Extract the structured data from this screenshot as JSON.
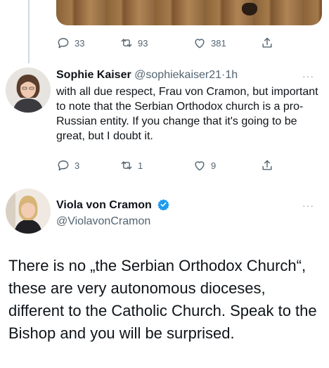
{
  "top_tweet": {
    "actions": {
      "replies": "33",
      "retweets": "93",
      "likes": "381"
    }
  },
  "reply": {
    "name": "Sophie Kaiser",
    "handle": "@sophiekaiser21",
    "separator": "·",
    "time": "1h",
    "text": "with all due respect, Frau von Cramon, but important to note that the Serbian Orthodox church is a pro-Russian entity. If you change that it's going to be great, but I doubt it.",
    "actions": {
      "replies": "3",
      "retweets": "1",
      "likes": "9"
    }
  },
  "main_tweet": {
    "name": "Viola von Cramon",
    "handle": "@ViolavonCramon",
    "verified_color": "#1d9bf0",
    "text": "There is no „the Serbian Orthodox Church“, these are very autonomous dioceses, different to the Catholic Church. Speak to the Bishop and you will be surprised."
  },
  "more_glyph": "···"
}
